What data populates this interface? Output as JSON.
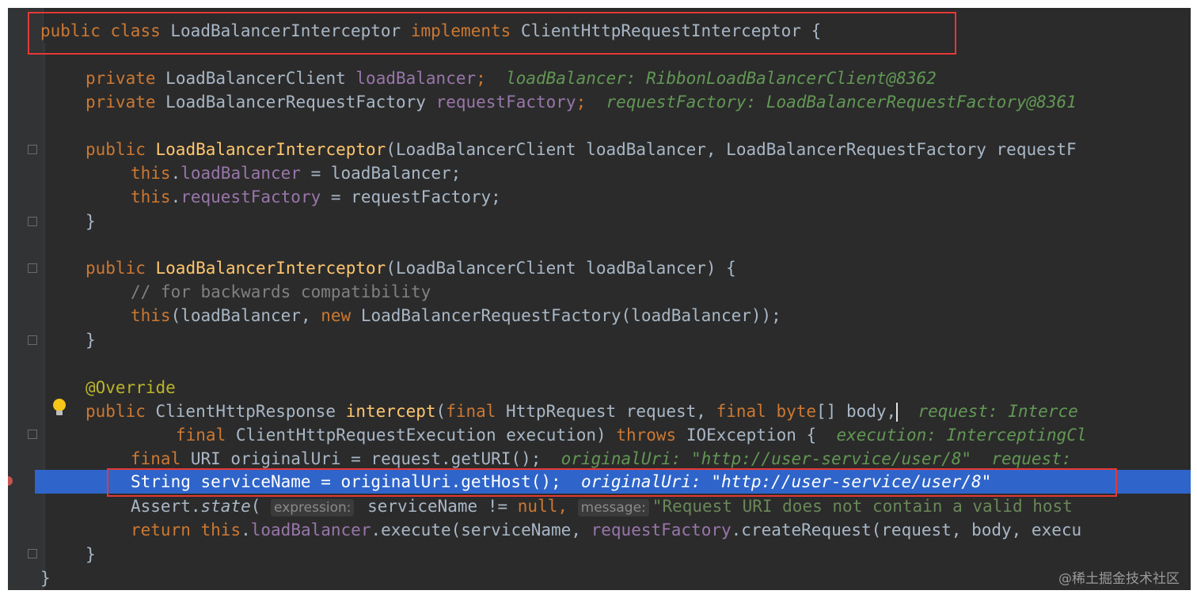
{
  "code": {
    "class_decl": {
      "kw_public": "public",
      "kw_class": "class",
      "name": "LoadBalancerInterceptor",
      "kw_implements": "implements",
      "iface": "ClientHttpRequestInterceptor",
      "brace": " {"
    },
    "field1": {
      "kw": "private",
      "type": "LoadBalancerClient",
      "name": "loadBalancer",
      "semi": ";",
      "hint": "loadBalancer: RibbonLoadBalancerClient@8362"
    },
    "field2": {
      "kw": "private",
      "type": "LoadBalancerRequestFactory",
      "name": "requestFactory",
      "semi": ";",
      "hint": "requestFactory: LoadBalancerRequestFactory@8361"
    },
    "ctor1": {
      "kw": "public",
      "name": "LoadBalancerInterceptor",
      "params": "(LoadBalancerClient loadBalancer, LoadBalancerRequestFactory requestF"
    },
    "ctor1_body1": {
      "kw": "this",
      "dot": ".",
      "field": "loadBalancer",
      "rest": " = loadBalancer;"
    },
    "ctor1_body2": {
      "kw": "this",
      "dot": ".",
      "field": "requestFactory",
      "rest": " = requestFactory;"
    },
    "close_brace": "}",
    "ctor2": {
      "kw": "public",
      "name": "LoadBalancerInterceptor",
      "params": "(LoadBalancerClient loadBalancer) {"
    },
    "comment": "// for backwards compatibility",
    "ctor2_body": {
      "kw_this": "this",
      "mid": "(loadBalancer, ",
      "kw_new": "new",
      "rest": " LoadBalancerRequestFactory(loadBalancer));"
    },
    "annotation": "@Override",
    "method_sig1": {
      "kw_public": "public",
      "type": " ClientHttpResponse ",
      "name": "intercept",
      "p1": "(",
      "kw_final": "final",
      "p2": " HttpRequest request, ",
      "kw_final2": "final",
      "p3": " ",
      "kw_byte": "byte",
      "p4": "[] body,",
      "hint": "request: Interce"
    },
    "method_sig2": {
      "kw_final": "final",
      "p1": " ClientHttpRequestExecution execution) ",
      "kw_throws": "throws",
      "p2": " IOException {",
      "hint": "execution: InterceptingCl"
    },
    "uri_line": {
      "kw_final": "final",
      "code": " URI originalUri = request.getURI();",
      "hint1": "originalUri: \"http://user-service/user/8\"",
      "hint2": "request: "
    },
    "exec_line": {
      "code": "String serviceName = originalUri.getHost();",
      "hint": "originalUri: \"http://user-service/user/8\""
    },
    "assert_line": {
      "a": "Assert.",
      "state": "state",
      "b": "(",
      "hint1": "expression:",
      "c": " serviceName != ",
      "kw_null": "null",
      "d": ", ",
      "hint2": "message:",
      "e": "\"Request URI does not contain a valid host"
    },
    "return_line": {
      "kw_return": "return",
      "sp": " ",
      "kw_this": "this",
      "dot": ".",
      "field": "loadBalancer",
      "a": ".execute(serviceName, ",
      "field2": "requestFactory",
      "b": ".createRequest(request, body, execu"
    }
  },
  "watermark": "@稀土掘金技术社区",
  "colors": {
    "background": "#2b2b2b",
    "keyword": "#cc7832",
    "method": "#ffc66d",
    "field": "#9876aa",
    "highlight": "#e53935",
    "execution_line": "#2f65ca"
  },
  "icons": [
    "fold-marker-icon",
    "lightbulb-icon",
    "breakpoint-icon"
  ]
}
